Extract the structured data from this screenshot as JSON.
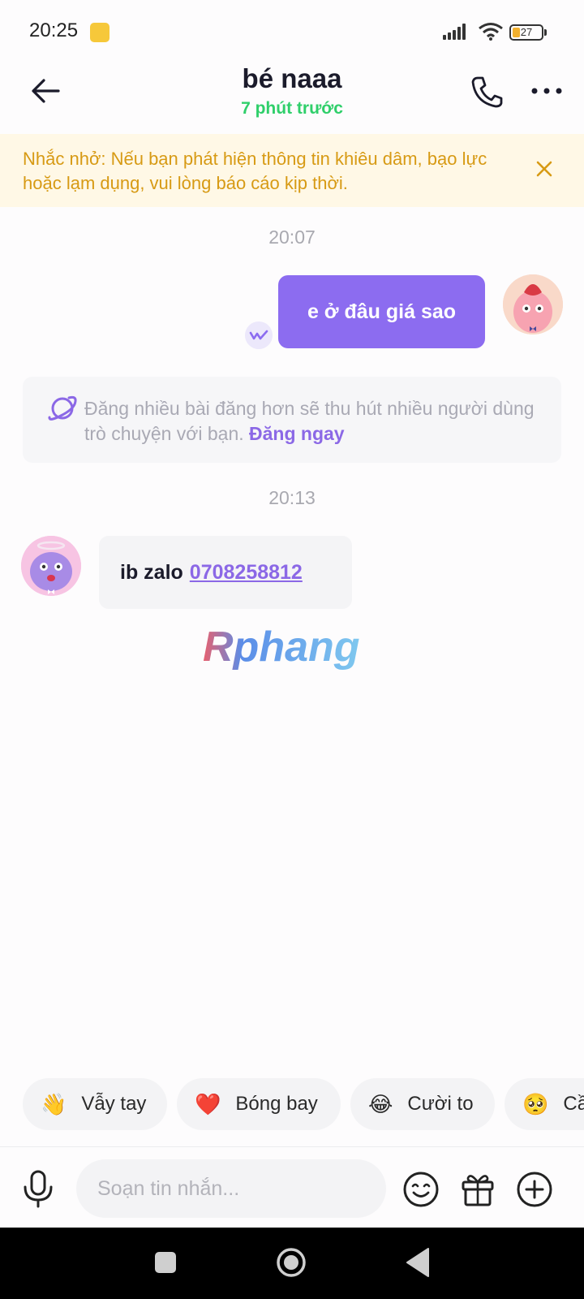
{
  "status_bar": {
    "time": "20:25",
    "battery": "27"
  },
  "header": {
    "title": "bé naaa",
    "subtitle": "7 phút trước"
  },
  "reminder": {
    "text": "Nhắc nhở: Nếu bạn phát hiện thông tin khiêu dâm, bạo lực hoặc lạm dụng, vui lòng báo cáo kịp thời."
  },
  "messages": {
    "time1": "20:07",
    "sent_text": "e ở đâu giá sao",
    "tip_text": "Đăng nhiều bài đăng hơn sẽ thu hút nhiều người dùng trò chuyện với bạn.",
    "tip_link": "Đăng ngay",
    "time2": "20:13",
    "received_prefix": "ib zalo",
    "received_link": "0708258812"
  },
  "watermark": {
    "text": "Rphang"
  },
  "quick_reactions": [
    {
      "emoji": "👋",
      "label": "Vẫy tay"
    },
    {
      "emoji": "❤️",
      "label": "Bóng bay"
    },
    {
      "emoji": "😂",
      "label": "Cười to"
    },
    {
      "emoji": "🥺",
      "label": "Cầ"
    }
  ],
  "composer": {
    "placeholder": "Soạn tin nhắn..."
  },
  "colors": {
    "accent": "#8c6cf0",
    "online": "#2fcf6a",
    "warning_text": "#d79a14",
    "warning_bg": "#fff8e6"
  }
}
